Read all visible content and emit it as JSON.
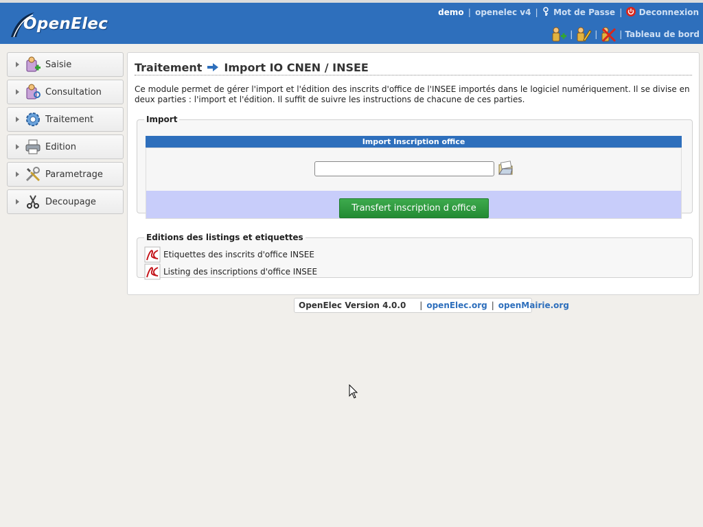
{
  "header": {
    "logo_text": "OpenElec",
    "user": "demo",
    "collectivite": "openelec v4",
    "password_link": "Mot de Passe",
    "logout_link": "Deconnexion",
    "dashboard_link": "Tableau de bord",
    "shortcut_icons": [
      "add-person-icon",
      "edit-person-icon",
      "remove-person-icon"
    ]
  },
  "sidebar": {
    "items": [
      {
        "label": "Saisie",
        "icon": "saisie-icon"
      },
      {
        "label": "Consultation",
        "icon": "consultation-icon"
      },
      {
        "label": "Traitement",
        "icon": "traitement-gear-icon"
      },
      {
        "label": "Edition",
        "icon": "printer-icon"
      },
      {
        "label": "Parametrage",
        "icon": "tools-icon"
      },
      {
        "label": "Decoupage",
        "icon": "scissors-icon"
      }
    ]
  },
  "main": {
    "breadcrumb_1": "Traitement",
    "breadcrumb_2": "Import IO CNEN / INSEE",
    "intro": "Ce module permet de gérer l'import et l'édition des inscrits d'office de l'INSEE importés dans le logiciel numériquement. Il se divise en deux parties : l'import et l'édition. Il suffit de suivre les instructions de chacune de ces parties.",
    "import": {
      "legend": "Import",
      "bar_title": "Import Inscription office",
      "file_value": "",
      "submit_label": "Transfert inscription d office"
    },
    "editions": {
      "legend": "Editions des listings et etiquettes",
      "items": [
        "Etiquettes des inscrits d'office INSEE",
        "Listing des inscriptions d'office INSEE"
      ]
    }
  },
  "footer": {
    "version": "OpenElec Version 4.0.0",
    "link1": "openElec.org",
    "link2": "openMairie.org"
  },
  "colors": {
    "header_blue": "#2e6fbc",
    "submit_green": "#2f9a3f",
    "submit_row_bg": "#c8cdfa"
  }
}
